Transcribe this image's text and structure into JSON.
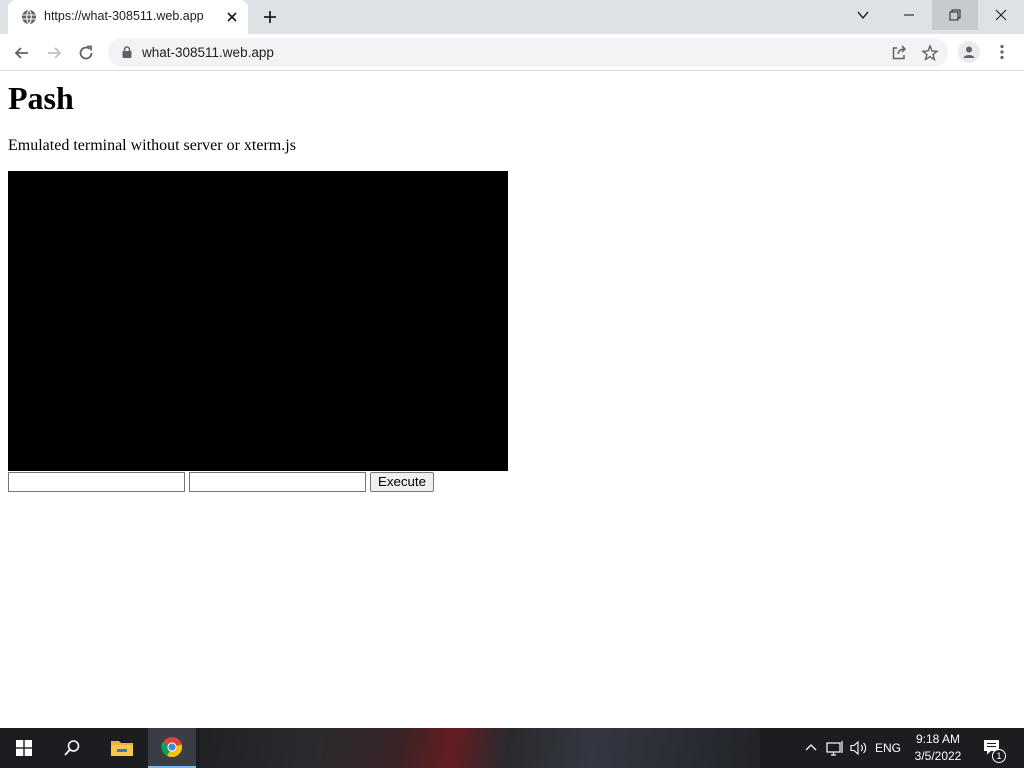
{
  "browser": {
    "tab_title": "https://what-308511.web.app",
    "url": "what-308511.web.app"
  },
  "page": {
    "heading": "Pash",
    "subtitle": "Emulated terminal without server or xterm.js",
    "input_a_value": "",
    "input_b_value": "",
    "execute_label": "Execute"
  },
  "taskbar": {
    "language": "ENG",
    "time": "9:18 AM",
    "date": "3/5/2022",
    "notification_count": "1"
  },
  "colors": {
    "chrome_bg": "#dee1e6",
    "omnibox_bg": "#f1f3f4",
    "terminal_bg": "#000000",
    "taskbar_bg": "#1b1d21",
    "active_indicator": "#76b9ed"
  },
  "icons": {
    "tab_favicon": "globe-icon",
    "tab_close": "close-icon",
    "new_tab": "plus-icon",
    "tab_search": "chevron-down-icon",
    "minimize": "minimize-icon",
    "restore": "restore-icon",
    "close_window": "close-icon",
    "back": "back-arrow-icon",
    "forward": "forward-arrow-icon",
    "reload": "reload-icon",
    "lock": "lock-icon",
    "share": "share-icon",
    "bookmark": "star-icon",
    "profile": "profile-icon",
    "menu": "vertical-dots-icon",
    "start": "windows-start-icon",
    "search": "search-icon",
    "file_explorer": "folder-icon",
    "chrome": "chrome-icon",
    "tray_overflow": "chevron-up-icon",
    "network": "network-icon",
    "volume": "speaker-icon",
    "notifications": "notification-icon"
  }
}
